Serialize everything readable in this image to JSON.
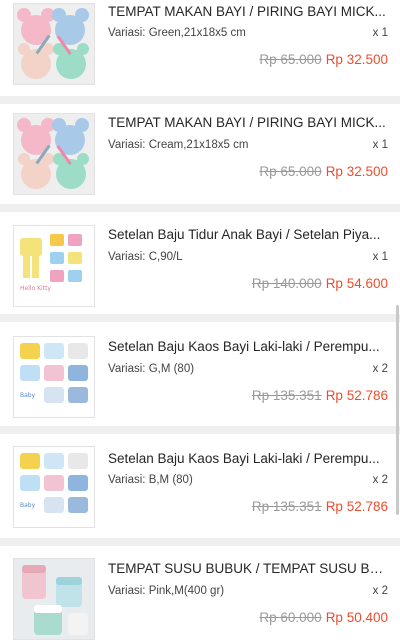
{
  "items": [
    {
      "title": "TEMPAT MAKAN BAYI / PIRING BAYI MICK...",
      "variant": "Variasi: Green,21x18x5 cm",
      "qty": "x 1",
      "old_price": "Rp 65.000",
      "new_price": "Rp 32.500",
      "thumb": "mickey-plates"
    },
    {
      "title": "TEMPAT MAKAN BAYI / PIRING BAYI MICK...",
      "variant": "Variasi: Cream,21x18x5 cm",
      "qty": "x 1",
      "old_price": "Rp 65.000",
      "new_price": "Rp 32.500",
      "thumb": "mickey-plates"
    },
    {
      "title": "Setelan Baju Tidur Anak Bayi / Setelan Piya...",
      "variant": "Variasi: C,90/L",
      "qty": "x 1",
      "old_price": "Rp 140.000",
      "new_price": "Rp 54.600",
      "thumb": "pajama-set"
    },
    {
      "title": "Setelan Baju Kaos Bayi Laki-laki / Perempu...",
      "variant": "Variasi: G,M (80)",
      "qty": "x 2",
      "old_price": "Rp 135.351",
      "new_price": "Rp 52.786",
      "thumb": "baby-clothes"
    },
    {
      "title": "Setelan Baju Kaos Bayi Laki-laki / Perempu...",
      "variant": "Variasi: B,M (80)",
      "qty": "x 2",
      "old_price": "Rp 135.351",
      "new_price": "Rp 52.786",
      "thumb": "baby-clothes"
    },
    {
      "title": "TEMPAT SUSU BUBUK / TEMPAT SUSU BU...",
      "variant": "Variasi: Pink,M(400 gr)",
      "qty": "x 2",
      "old_price": "Rp 60.000",
      "new_price": "Rp 50.400",
      "thumb": "milk-container"
    }
  ],
  "colors": {
    "price": "#ee4d2d",
    "old_price": "#9a9a9a",
    "background": "#efefef"
  }
}
